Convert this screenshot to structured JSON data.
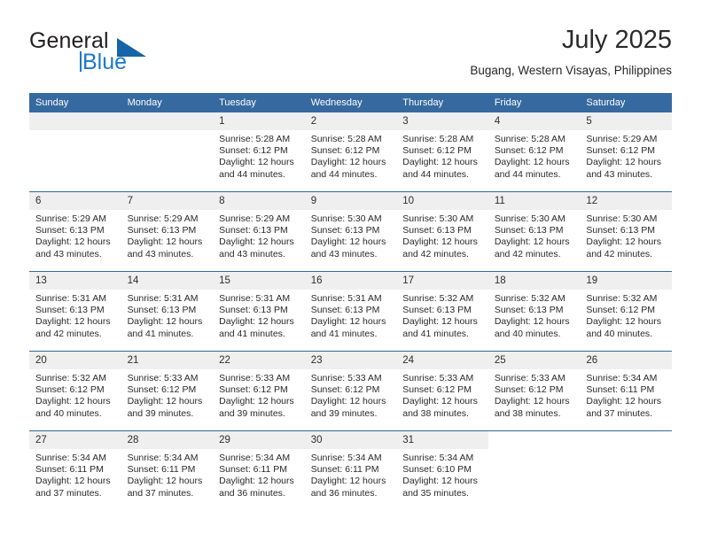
{
  "brand": {
    "name_part1": "General",
    "name_part2": "Blue",
    "accent_color": "#1b79c8",
    "triangle_color": "#1565a8"
  },
  "header": {
    "month_title": "July 2025",
    "location": "Bugang, Western Visayas, Philippines"
  },
  "calendar": {
    "header_bg": "#36699f",
    "daynum_bg": "#efefef",
    "weekday_headers": [
      "Sunday",
      "Monday",
      "Tuesday",
      "Wednesday",
      "Thursday",
      "Friday",
      "Saturday"
    ],
    "labels": {
      "sunrise": "Sunrise:",
      "sunset": "Sunset:",
      "daylight": "Daylight:"
    },
    "weeks": [
      [
        {
          "day": "",
          "sunrise": "",
          "sunset": "",
          "daylight_l1": "",
          "daylight_l2": ""
        },
        {
          "day": "",
          "sunrise": "",
          "sunset": "",
          "daylight_l1": "",
          "daylight_l2": ""
        },
        {
          "day": "1",
          "sunrise": "Sunrise: 5:28 AM",
          "sunset": "Sunset: 6:12 PM",
          "daylight_l1": "Daylight: 12 hours",
          "daylight_l2": "and 44 minutes."
        },
        {
          "day": "2",
          "sunrise": "Sunrise: 5:28 AM",
          "sunset": "Sunset: 6:12 PM",
          "daylight_l1": "Daylight: 12 hours",
          "daylight_l2": "and 44 minutes."
        },
        {
          "day": "3",
          "sunrise": "Sunrise: 5:28 AM",
          "sunset": "Sunset: 6:12 PM",
          "daylight_l1": "Daylight: 12 hours",
          "daylight_l2": "and 44 minutes."
        },
        {
          "day": "4",
          "sunrise": "Sunrise: 5:28 AM",
          "sunset": "Sunset: 6:12 PM",
          "daylight_l1": "Daylight: 12 hours",
          "daylight_l2": "and 44 minutes."
        },
        {
          "day": "5",
          "sunrise": "Sunrise: 5:29 AM",
          "sunset": "Sunset: 6:12 PM",
          "daylight_l1": "Daylight: 12 hours",
          "daylight_l2": "and 43 minutes."
        }
      ],
      [
        {
          "day": "6",
          "sunrise": "Sunrise: 5:29 AM",
          "sunset": "Sunset: 6:13 PM",
          "daylight_l1": "Daylight: 12 hours",
          "daylight_l2": "and 43 minutes."
        },
        {
          "day": "7",
          "sunrise": "Sunrise: 5:29 AM",
          "sunset": "Sunset: 6:13 PM",
          "daylight_l1": "Daylight: 12 hours",
          "daylight_l2": "and 43 minutes."
        },
        {
          "day": "8",
          "sunrise": "Sunrise: 5:29 AM",
          "sunset": "Sunset: 6:13 PM",
          "daylight_l1": "Daylight: 12 hours",
          "daylight_l2": "and 43 minutes."
        },
        {
          "day": "9",
          "sunrise": "Sunrise: 5:30 AM",
          "sunset": "Sunset: 6:13 PM",
          "daylight_l1": "Daylight: 12 hours",
          "daylight_l2": "and 43 minutes."
        },
        {
          "day": "10",
          "sunrise": "Sunrise: 5:30 AM",
          "sunset": "Sunset: 6:13 PM",
          "daylight_l1": "Daylight: 12 hours",
          "daylight_l2": "and 42 minutes."
        },
        {
          "day": "11",
          "sunrise": "Sunrise: 5:30 AM",
          "sunset": "Sunset: 6:13 PM",
          "daylight_l1": "Daylight: 12 hours",
          "daylight_l2": "and 42 minutes."
        },
        {
          "day": "12",
          "sunrise": "Sunrise: 5:30 AM",
          "sunset": "Sunset: 6:13 PM",
          "daylight_l1": "Daylight: 12 hours",
          "daylight_l2": "and 42 minutes."
        }
      ],
      [
        {
          "day": "13",
          "sunrise": "Sunrise: 5:31 AM",
          "sunset": "Sunset: 6:13 PM",
          "daylight_l1": "Daylight: 12 hours",
          "daylight_l2": "and 42 minutes."
        },
        {
          "day": "14",
          "sunrise": "Sunrise: 5:31 AM",
          "sunset": "Sunset: 6:13 PM",
          "daylight_l1": "Daylight: 12 hours",
          "daylight_l2": "and 41 minutes."
        },
        {
          "day": "15",
          "sunrise": "Sunrise: 5:31 AM",
          "sunset": "Sunset: 6:13 PM",
          "daylight_l1": "Daylight: 12 hours",
          "daylight_l2": "and 41 minutes."
        },
        {
          "day": "16",
          "sunrise": "Sunrise: 5:31 AM",
          "sunset": "Sunset: 6:13 PM",
          "daylight_l1": "Daylight: 12 hours",
          "daylight_l2": "and 41 minutes."
        },
        {
          "day": "17",
          "sunrise": "Sunrise: 5:32 AM",
          "sunset": "Sunset: 6:13 PM",
          "daylight_l1": "Daylight: 12 hours",
          "daylight_l2": "and 41 minutes."
        },
        {
          "day": "18",
          "sunrise": "Sunrise: 5:32 AM",
          "sunset": "Sunset: 6:13 PM",
          "daylight_l1": "Daylight: 12 hours",
          "daylight_l2": "and 40 minutes."
        },
        {
          "day": "19",
          "sunrise": "Sunrise: 5:32 AM",
          "sunset": "Sunset: 6:12 PM",
          "daylight_l1": "Daylight: 12 hours",
          "daylight_l2": "and 40 minutes."
        }
      ],
      [
        {
          "day": "20",
          "sunrise": "Sunrise: 5:32 AM",
          "sunset": "Sunset: 6:12 PM",
          "daylight_l1": "Daylight: 12 hours",
          "daylight_l2": "and 40 minutes."
        },
        {
          "day": "21",
          "sunrise": "Sunrise: 5:33 AM",
          "sunset": "Sunset: 6:12 PM",
          "daylight_l1": "Daylight: 12 hours",
          "daylight_l2": "and 39 minutes."
        },
        {
          "day": "22",
          "sunrise": "Sunrise: 5:33 AM",
          "sunset": "Sunset: 6:12 PM",
          "daylight_l1": "Daylight: 12 hours",
          "daylight_l2": "and 39 minutes."
        },
        {
          "day": "23",
          "sunrise": "Sunrise: 5:33 AM",
          "sunset": "Sunset: 6:12 PM",
          "daylight_l1": "Daylight: 12 hours",
          "daylight_l2": "and 39 minutes."
        },
        {
          "day": "24",
          "sunrise": "Sunrise: 5:33 AM",
          "sunset": "Sunset: 6:12 PM",
          "daylight_l1": "Daylight: 12 hours",
          "daylight_l2": "and 38 minutes."
        },
        {
          "day": "25",
          "sunrise": "Sunrise: 5:33 AM",
          "sunset": "Sunset: 6:12 PM",
          "daylight_l1": "Daylight: 12 hours",
          "daylight_l2": "and 38 minutes."
        },
        {
          "day": "26",
          "sunrise": "Sunrise: 5:34 AM",
          "sunset": "Sunset: 6:11 PM",
          "daylight_l1": "Daylight: 12 hours",
          "daylight_l2": "and 37 minutes."
        }
      ],
      [
        {
          "day": "27",
          "sunrise": "Sunrise: 5:34 AM",
          "sunset": "Sunset: 6:11 PM",
          "daylight_l1": "Daylight: 12 hours",
          "daylight_l2": "and 37 minutes."
        },
        {
          "day": "28",
          "sunrise": "Sunrise: 5:34 AM",
          "sunset": "Sunset: 6:11 PM",
          "daylight_l1": "Daylight: 12 hours",
          "daylight_l2": "and 37 minutes."
        },
        {
          "day": "29",
          "sunrise": "Sunrise: 5:34 AM",
          "sunset": "Sunset: 6:11 PM",
          "daylight_l1": "Daylight: 12 hours",
          "daylight_l2": "and 36 minutes."
        },
        {
          "day": "30",
          "sunrise": "Sunrise: 5:34 AM",
          "sunset": "Sunset: 6:11 PM",
          "daylight_l1": "Daylight: 12 hours",
          "daylight_l2": "and 36 minutes."
        },
        {
          "day": "31",
          "sunrise": "Sunrise: 5:34 AM",
          "sunset": "Sunset: 6:10 PM",
          "daylight_l1": "Daylight: 12 hours",
          "daylight_l2": "and 35 minutes."
        },
        {
          "day": "",
          "sunrise": "",
          "sunset": "",
          "daylight_l1": "",
          "daylight_l2": ""
        },
        {
          "day": "",
          "sunrise": "",
          "sunset": "",
          "daylight_l1": "",
          "daylight_l2": ""
        }
      ]
    ]
  }
}
